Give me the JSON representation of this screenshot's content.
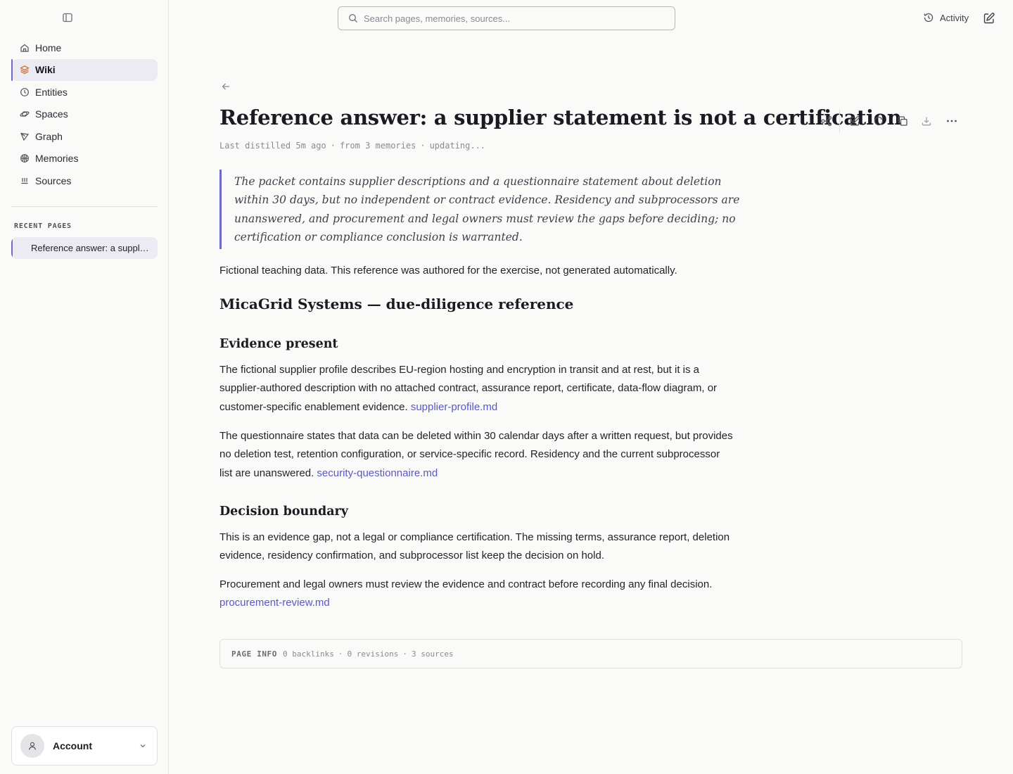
{
  "sidebar": {
    "nav": [
      {
        "label": "Home",
        "icon": "home-icon"
      },
      {
        "label": "Wiki",
        "icon": "layers-icon",
        "active": true
      },
      {
        "label": "Entities",
        "icon": "clock-icon"
      },
      {
        "label": "Spaces",
        "icon": "orbit-icon"
      },
      {
        "label": "Graph",
        "icon": "graph-icon"
      },
      {
        "label": "Memories",
        "icon": "brain-icon"
      },
      {
        "label": "Sources",
        "icon": "inbox-icon"
      }
    ],
    "recent_title": "RECENT PAGES",
    "recent": [
      {
        "label": "Reference answer: a supplier statement is not a certification"
      }
    ],
    "account_label": "Account"
  },
  "topbar": {
    "search_placeholder": "Search pages, memories, sources...",
    "activity_label": "Activity"
  },
  "page": {
    "title": "Reference answer: a supplier statement is not a certification",
    "meta": {
      "distilled": "Last distilled 5m ago",
      "from": "from 3 memories",
      "status": "updating..."
    },
    "summary": "The packet contains supplier descriptions and a questionnaire statement about deletion within 30 days, but no independent or contract evidence. Residency and subprocessors are unanswered, and procurement and legal owners must review the gaps before deciding; no certification or compliance conclusion is warranted.",
    "disclaimer": "Fictional teaching data. This reference was authored for the exercise, not generated automatically.",
    "heading": "MicaGrid Systems — due-diligence reference",
    "sections": [
      {
        "heading": "Evidence present",
        "paragraphs": [
          {
            "text": "The fictional supplier profile describes EU-region hosting and encryption in transit and at rest, but it is a supplier-authored description with no attached contract, assurance report, certificate, data-flow diagram, or customer-specific enablement evidence.",
            "link": "supplier-profile.md"
          },
          {
            "text": "The questionnaire states that data can be deleted within 30 calendar days after a written request, but provides no deletion test, retention configuration, or service-specific record. Residency and the current subprocessor list are unanswered.",
            "link": "security-questionnaire.md"
          }
        ]
      },
      {
        "heading": "Decision boundary",
        "paragraphs": [
          {
            "text": "This is an evidence gap, not a legal or compliance certification. The missing terms, assurance report, deletion evidence, residency confirmation, and subprocessor list keep the decision on hold.",
            "link": ""
          },
          {
            "text": "Procurement and legal owners must review the evidence and contract before recording any final decision.",
            "link": "procurement-review.md"
          }
        ]
      }
    ],
    "page_info": {
      "title": "PAGE INFO",
      "backlinks": "0 backlinks",
      "revisions": "0 revisions",
      "sources": "3 sources"
    }
  },
  "colors": {
    "accent": "#6d6bc7",
    "link": "#5b57c4",
    "background": "#fafaf9"
  }
}
